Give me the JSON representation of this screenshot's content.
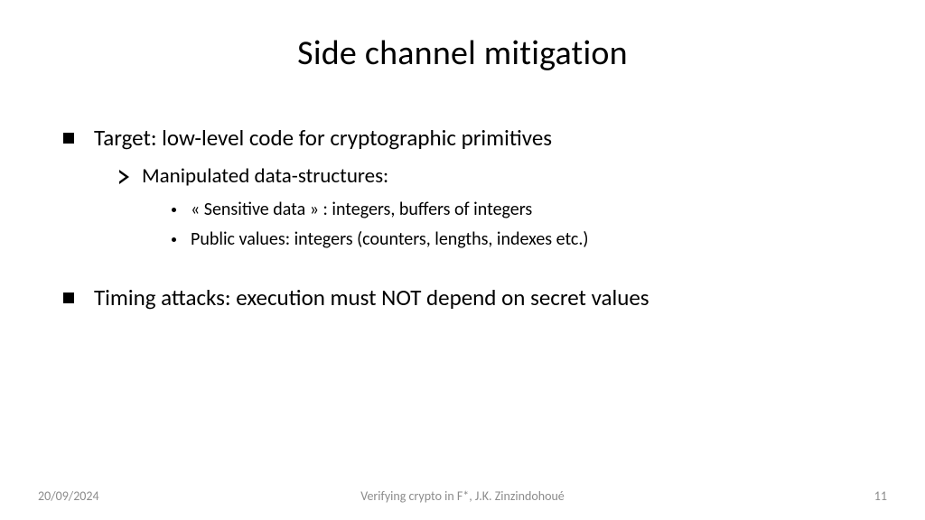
{
  "title": "Side channel mitigation",
  "bullets": {
    "b1": "Target: low-level code for cryptographic primitives",
    "b1_1": "Manipulated data-structures:",
    "b1_1_1": "« Sensitive data » : integers, buffers of integers",
    "b1_1_2": "Public values: integers (counters, lengths, indexes etc.)",
    "b2": "Timing attacks: execution must NOT depend on secret values"
  },
  "footer": {
    "date": "20/09/2024",
    "center": "Verifying crypto  in F*, J.K. Zinzindohoué",
    "page": "11"
  }
}
